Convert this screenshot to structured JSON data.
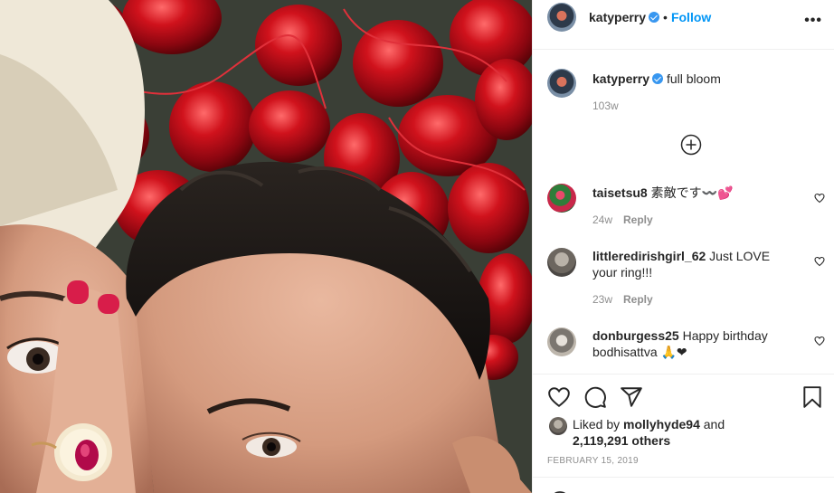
{
  "post": {
    "username": "katyperry",
    "follow_label": "Follow",
    "separator": "•",
    "more_label": "•••"
  },
  "caption": {
    "username": "katyperry",
    "text": "full bloom",
    "time": "103w"
  },
  "comments": [
    {
      "username": "taisetsu8",
      "text": "素敵です〰️💕",
      "time": "24w",
      "reply_label": "Reply"
    },
    {
      "username": "littleredirishgirl_62",
      "text_line1": "Just LOVE",
      "text_line2": "your ring!!!",
      "time": "23w",
      "reply_label": "Reply"
    },
    {
      "username": "donburgess25",
      "text_line1": "Happy birthday",
      "text_line2": "bodhisattva 🙏❤"
    }
  ],
  "likes": {
    "prefix": "Liked by",
    "liker": "mollyhyde94",
    "and": "and",
    "count": "2,119,291 others"
  },
  "date": "FEBRUARY 15, 2019",
  "colors": {
    "link_blue": "#0095f6",
    "verified_blue": "#3897f0",
    "muted_text": "#8e8e8e",
    "divider": "#efefef"
  },
  "icons": [
    "verified-badge-icon",
    "more-options-icon",
    "load-more-comments-icon",
    "heart-icon",
    "comment-icon",
    "share-icon",
    "bookmark-icon"
  ]
}
